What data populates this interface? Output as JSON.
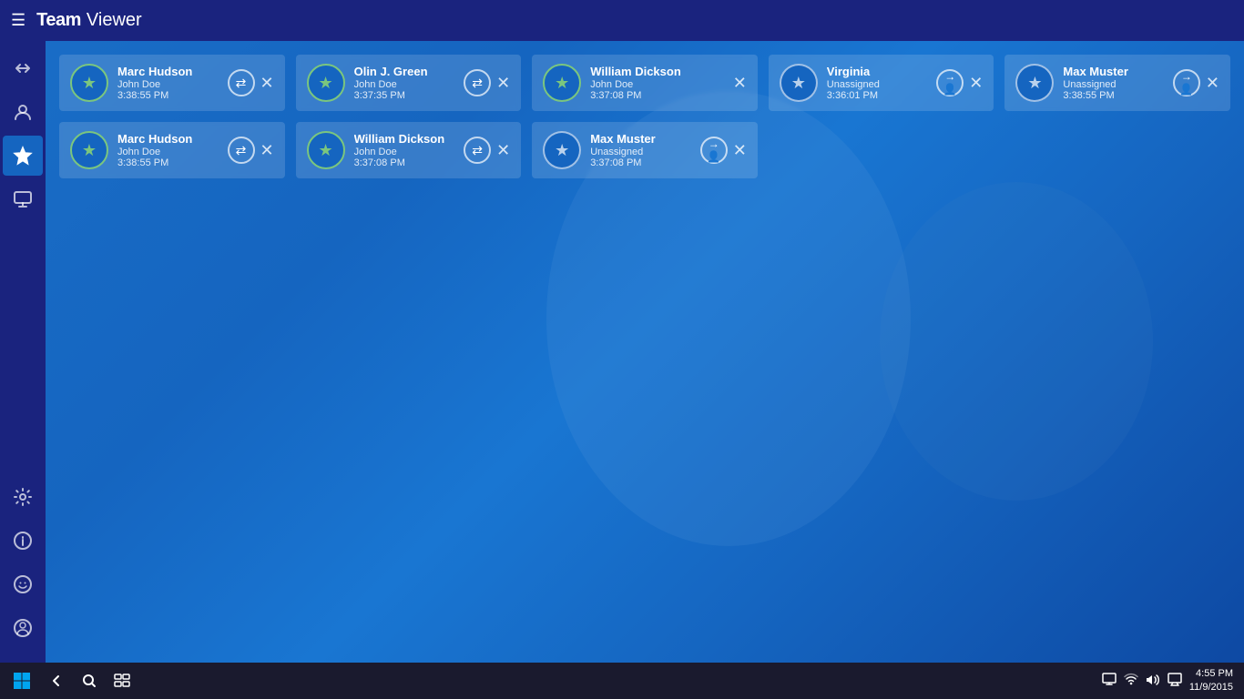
{
  "app": {
    "title_team": "Team",
    "title_viewer": "Viewer"
  },
  "sidebar": {
    "items": [
      {
        "id": "connections",
        "icon": "⇄",
        "label": "Connections",
        "active": false
      },
      {
        "id": "contacts",
        "icon": "👤",
        "label": "Contacts",
        "active": false
      },
      {
        "id": "favorites",
        "icon": "★",
        "label": "Favorites",
        "active": true
      },
      {
        "id": "computers",
        "icon": "⊞",
        "label": "Computers & Contacts",
        "active": false
      }
    ],
    "bottom_items": [
      {
        "id": "settings",
        "icon": "⚙",
        "label": "Settings"
      },
      {
        "id": "info",
        "icon": "ℹ",
        "label": "Info"
      },
      {
        "id": "feedback",
        "icon": "☺",
        "label": "Feedback"
      },
      {
        "id": "profile",
        "icon": "👤",
        "label": "Profile"
      }
    ]
  },
  "sessions": {
    "row1": [
      {
        "id": "s1",
        "name": "Marc Hudson",
        "user": "John Doe",
        "time": "3:38:55 PM",
        "assigned": true,
        "action": "switch"
      },
      {
        "id": "s2",
        "name": "Olin J. Green",
        "user": "John Doe",
        "time": "3:37:35 PM",
        "assigned": true,
        "action": "switch"
      },
      {
        "id": "s3",
        "name": "William Dickson",
        "user": "John Doe",
        "time": "3:37:08 PM",
        "assigned": true,
        "action": "none"
      },
      {
        "id": "s4",
        "name": "Virginia",
        "user": "Unassigned",
        "time": "3:36:01 PM",
        "assigned": false,
        "action": "assign"
      },
      {
        "id": "s5",
        "name": "Max Muster",
        "user": "Unassigned",
        "time": "3:38:55 PM",
        "assigned": false,
        "action": "assign"
      }
    ],
    "row2": [
      {
        "id": "s6",
        "name": "Marc Hudson",
        "user": "John Doe",
        "time": "3:38:55 PM",
        "assigned": true,
        "action": "switch"
      },
      {
        "id": "s7",
        "name": "William Dickson",
        "user": "John Doe",
        "time": "3:37:08 PM",
        "assigned": true,
        "action": "switch"
      },
      {
        "id": "s8",
        "name": "Max Muster",
        "user": "Unassigned",
        "time": "3:37:08 PM",
        "assigned": false,
        "action": "assign"
      }
    ]
  },
  "taskbar": {
    "clock_time": "4:55 PM",
    "clock_date": "11/9/2015"
  }
}
